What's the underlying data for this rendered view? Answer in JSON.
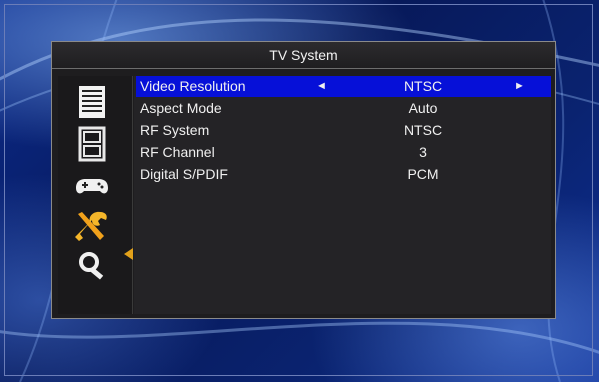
{
  "menu": {
    "title": "TV System",
    "sidebar_icons": [
      "document-icon",
      "film-icon",
      "gamepad-icon",
      "tools-icon",
      "search-icon"
    ],
    "selected_sidebar_index": 3,
    "items": [
      {
        "label": "Video Resolution",
        "value": "NTSC",
        "selected": true,
        "left_arrow": "◄",
        "right_arrow": "►"
      },
      {
        "label": "Aspect Mode",
        "value": "Auto",
        "selected": false
      },
      {
        "label": "RF System",
        "value": "NTSC",
        "selected": false
      },
      {
        "label": "RF Channel",
        "value": "3",
        "selected": false
      },
      {
        "label": "Digital S/PDIF",
        "value": "PCM",
        "selected": false
      }
    ]
  },
  "colors": {
    "selection": "#0610d8",
    "panel": "#1e1d1f",
    "pointer": "#e2a11a"
  }
}
